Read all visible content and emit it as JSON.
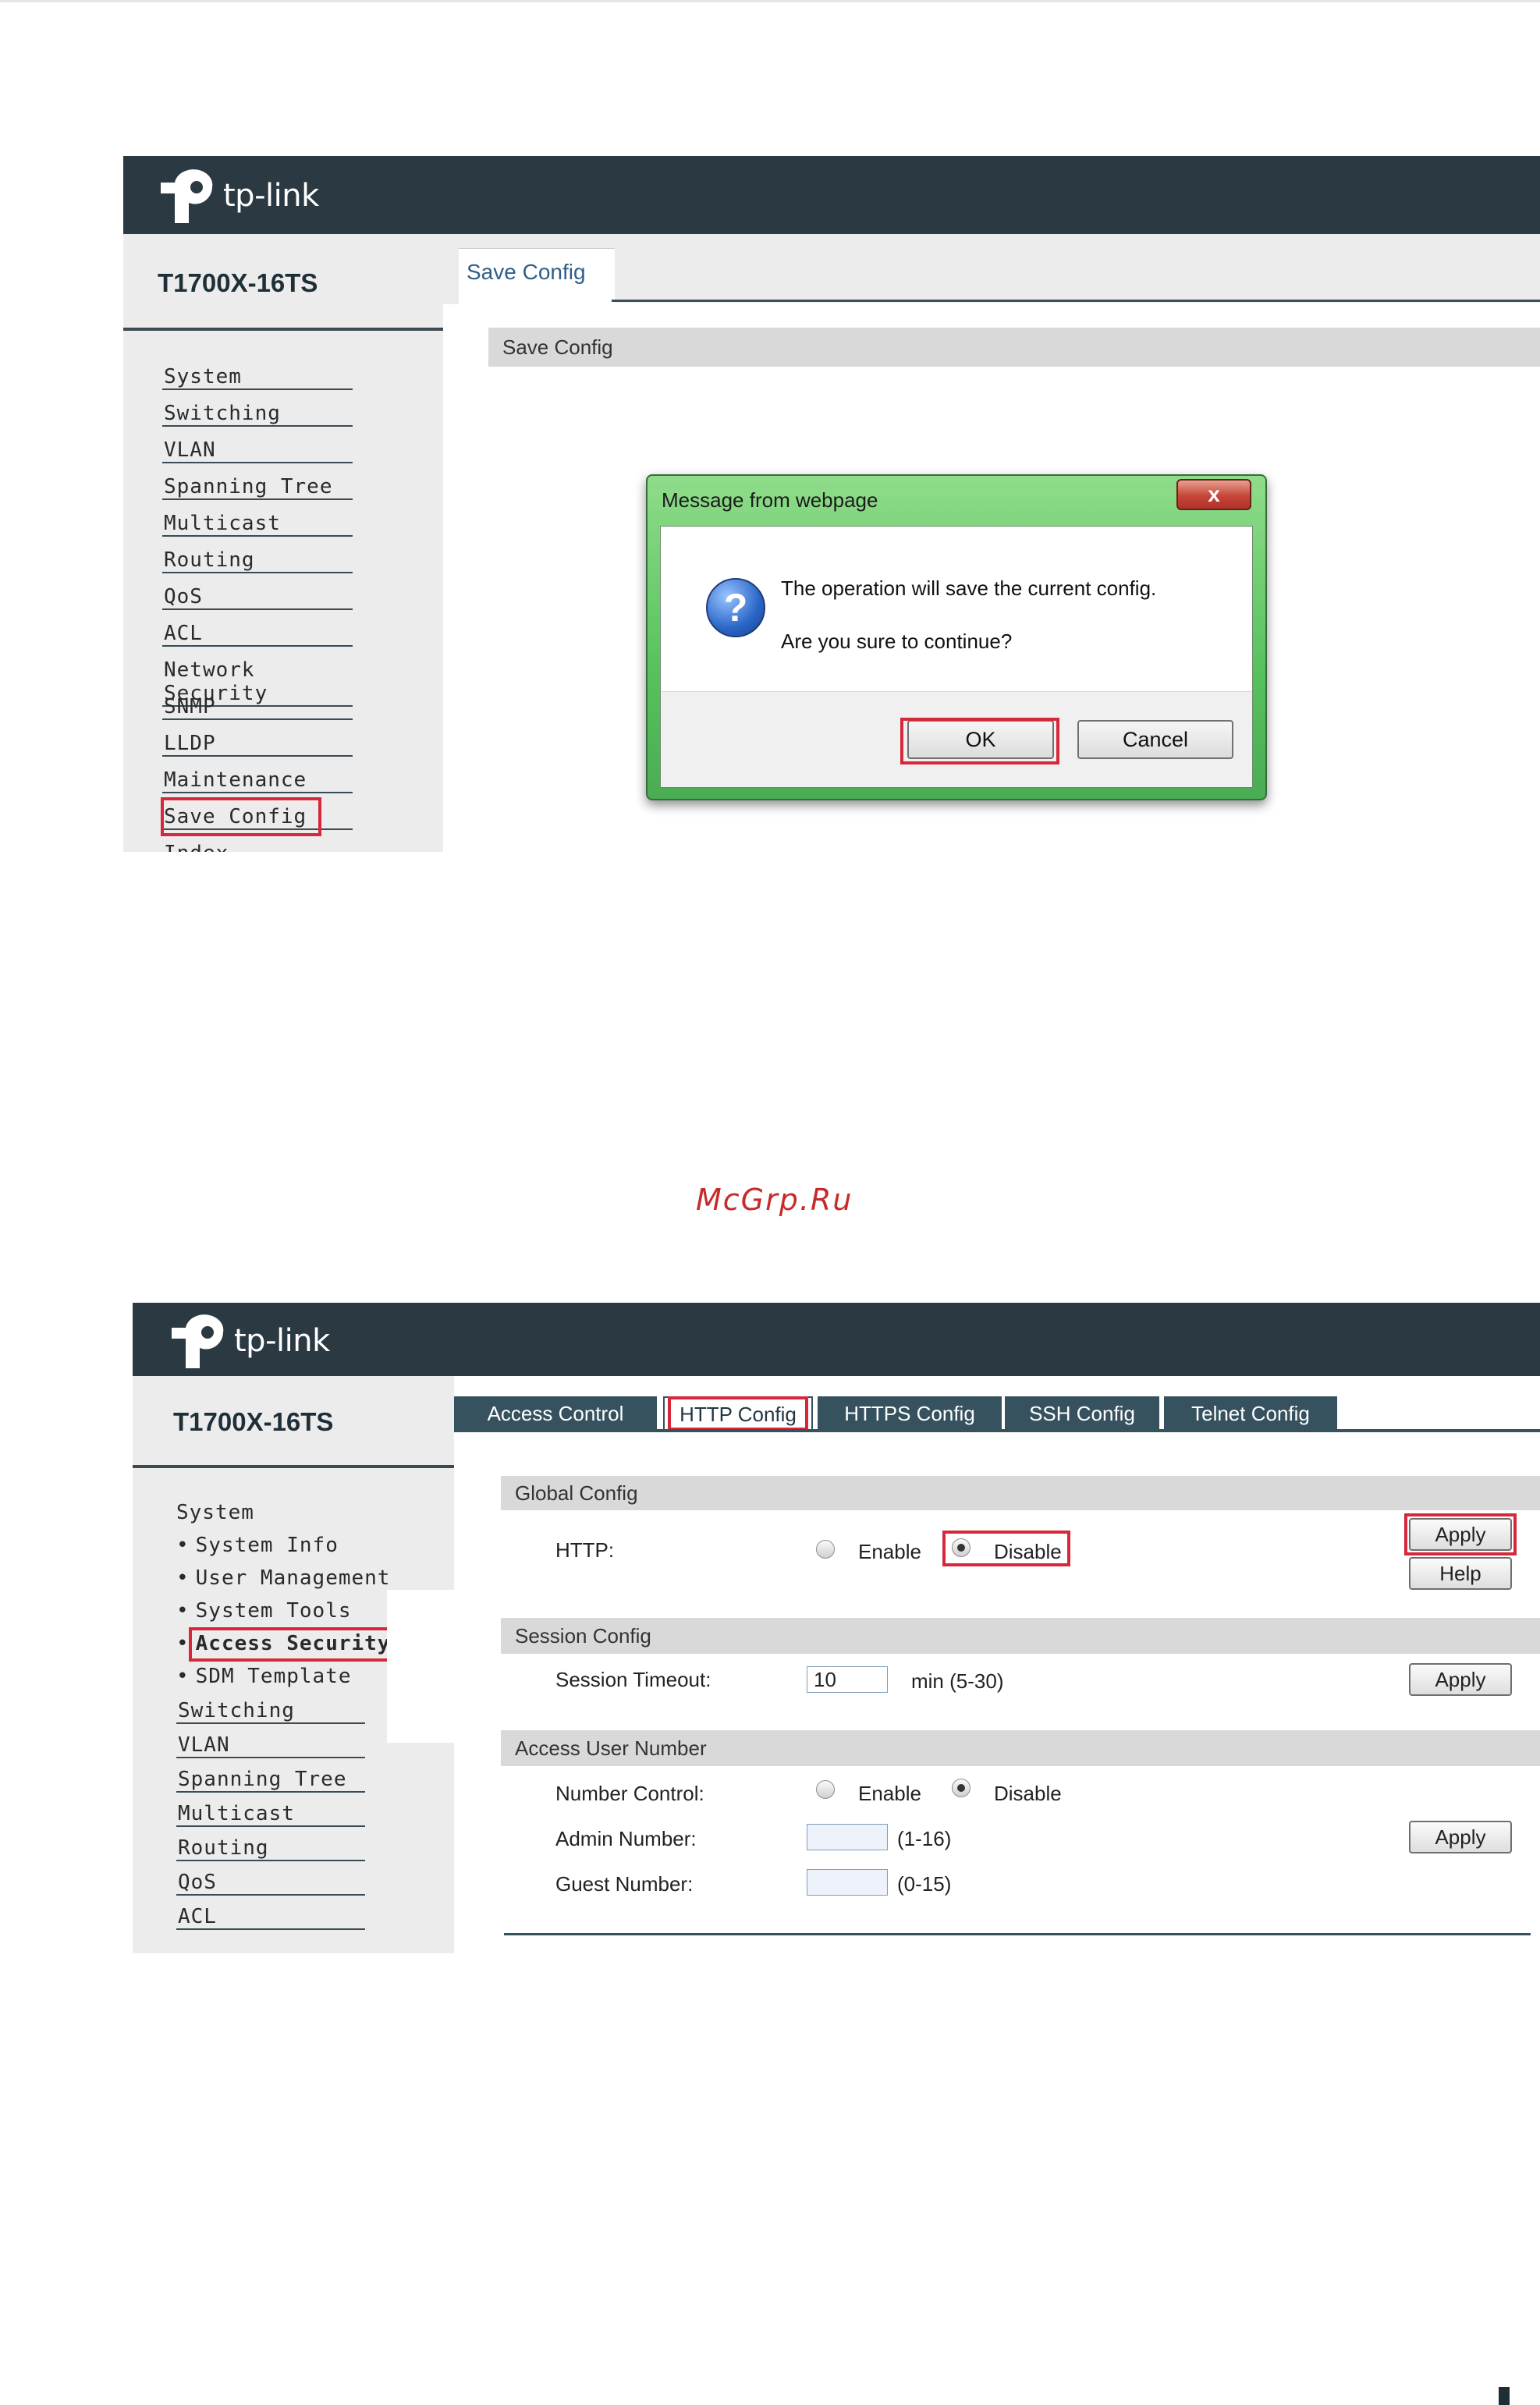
{
  "brand": {
    "logo_text": "tp-link",
    "model": "T1700X-16TS"
  },
  "panel1": {
    "tab": "Save Config",
    "section_title": "Save Config",
    "menu": [
      "System",
      "Switching",
      "VLAN",
      "Spanning Tree",
      "Multicast",
      "Routing",
      "QoS",
      "ACL",
      "Network Security",
      "SNMP",
      "LLDP",
      "Maintenance",
      "Save Config",
      "Index"
    ],
    "dialog": {
      "title": "Message from webpage",
      "close": "x",
      "line1": "The operation will save the current config.",
      "line2": "Are you sure to continue?",
      "ok": "OK",
      "cancel": "Cancel",
      "icon_glyph": "?"
    }
  },
  "watermark": "McGrp.Ru",
  "panel2": {
    "tabs": [
      "Access Control",
      "HTTP Config",
      "HTTPS Config",
      "SSH Config",
      "Telnet Config"
    ],
    "active_tab": "HTTP Config",
    "menu_top": "System",
    "submenu": [
      "System Info",
      "User Management",
      "System Tools",
      "Access Security",
      "SDM Template"
    ],
    "menu_rest": [
      "Switching",
      "VLAN",
      "Spanning Tree",
      "Multicast",
      "Routing",
      "QoS",
      "ACL"
    ],
    "bullet": "•",
    "global": {
      "title": "Global Config",
      "http_label": "HTTP:",
      "enable": "Enable",
      "disable": "Disable",
      "selected": "Disable",
      "apply": "Apply",
      "help": "Help"
    },
    "session": {
      "title": "Session Config",
      "label": "Session Timeout:",
      "value": "10",
      "unit": "min (5-30)",
      "apply": "Apply"
    },
    "access": {
      "title": "Access User Number",
      "control_label": "Number Control:",
      "enable": "Enable",
      "disable": "Disable",
      "selected": "Disable",
      "admin_label": "Admin Number:",
      "admin_value": "",
      "admin_range": "(1-16)",
      "guest_label": "Guest Number:",
      "guest_value": "",
      "guest_range": "(0-15)",
      "apply": "Apply"
    }
  },
  "colors": {
    "header": "#2b3a42",
    "highlight": "#d7283b",
    "tab": "#36525f",
    "sidebar": "#ececec"
  }
}
